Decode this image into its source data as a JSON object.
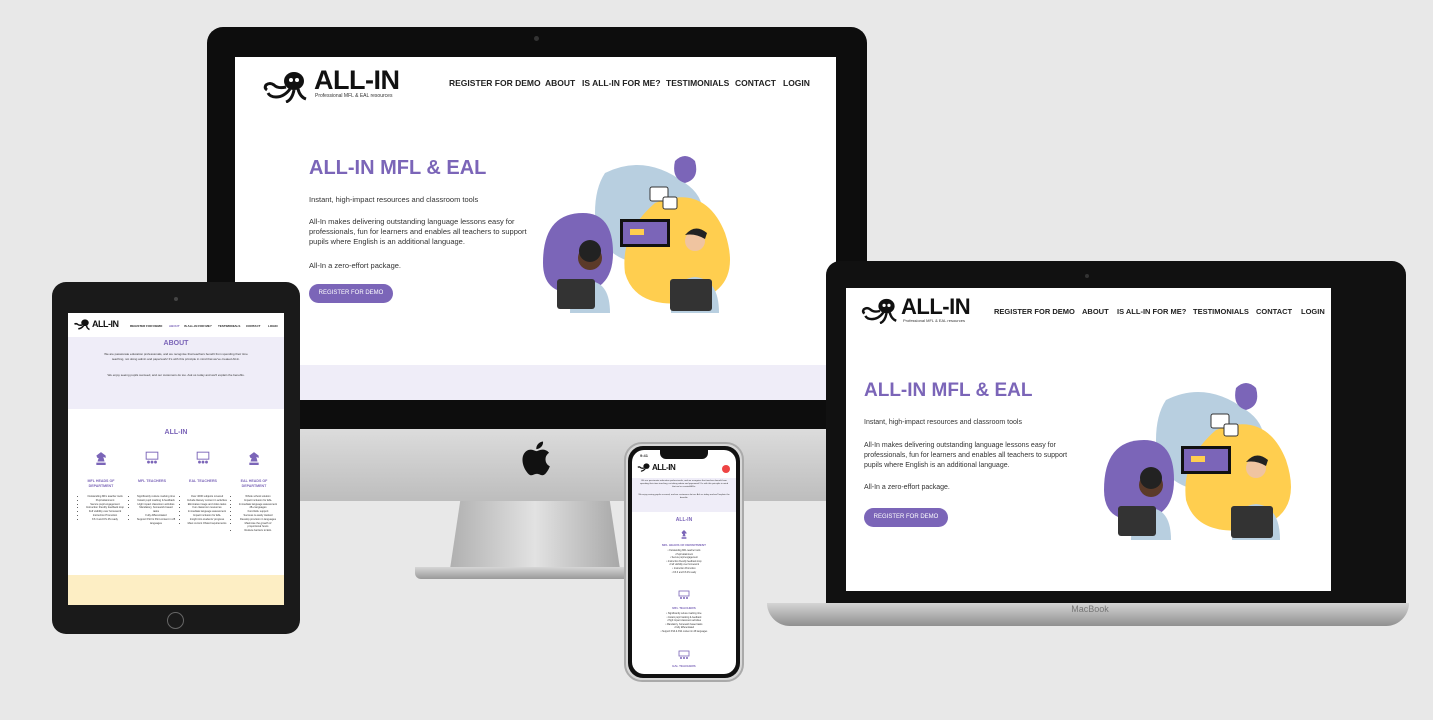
{
  "site": {
    "logo": "ALL-IN",
    "tagline": "Professional MFL & EAL resources",
    "nav": [
      "REGISTER FOR DEMO",
      "ABOUT",
      "IS ALL-IN FOR ME?",
      "TESTIMONIALS",
      "CONTACT",
      "LOGIN"
    ],
    "hero": {
      "title": "ALL-IN MFL & EAL",
      "p1": "Instant, high-impact resources and classroom tools",
      "p2": "All-In makes delivering outstanding language lessons easy for professionals, fun for learners and enables all teachers to support pupils where English is an additional language.",
      "p3": "All-In a zero-effort package.",
      "cta": "REGISTER FOR DEMO"
    }
  },
  "devices": {
    "macbook_label": "MacBook",
    "iphone_time": "9:41"
  },
  "tablet": {
    "about_title": "ABOUT",
    "about_p1": "We are passionate education professionals, and we recognise that teachers benefit from spending their time teaching, not doing admin and paperwork! It's with this principle in mind that we've created All-In.",
    "about_p2": "We enjoy seeing pupils succeed, and our customers do too. Ask us today and we'll explain the benefits.",
    "section_title": "ALL-IN",
    "columns": [
      {
        "title": "MFL HEADS OF DEPARTMENT",
        "items": [
          "Outstanding MFL teacher tools",
          "Pupil attainment",
          "Secure pupil engagement",
          "Instruction friendly feedback loop",
          "Full visibility over homework",
          "Instruction Promotion",
          "KS 3 and KS 4S ready"
        ]
      },
      {
        "title": "MFL TEACHERS",
        "items": [
          "Significantly reduce marking time",
          "Instant pupil marking & feedback",
          "High impact classroom activities",
          "Mandatory, homework based tasks",
          "Fully differentiated",
          "Support KS3 & KS4 content in 28 languages"
        ]
      },
      {
        "title": "EAL TEACHERS",
        "items": [
          "Over 4000 subjects covered",
          "Include literacy content in activities",
          "Eliminates image and video tasks",
          "Fun classroom resources",
          "Immediate language assessment",
          "Impact inclusion for EAL",
          "Insight into students' progress",
          "Meet current Ofsted requirements"
        ]
      },
      {
        "title": "EAL HEADS OF DEPARTMENT",
        "items": [
          "Whole school solution",
          "Impact inclusion for EAL",
          "Immediate language assessment",
          "28+ languages",
          "Fund EAL support",
          "Success is easily tracked",
          "Develop provision in languages",
          "Maximise the growth of proportional hours",
          "Reduce barriers to EAL"
        ]
      }
    ]
  },
  "phone": {
    "logo": "ALL-IN",
    "about_p1": "We are passionate education professionals, and we recognise that teachers benefit from spending their time teaching, not doing admin and paperwork! It's with this principle in mind that we've created All-In.",
    "about_p2": "We enjoy seeing pupils succeed, and our customers do too. Ask us today and we'll explain the benefits.",
    "section_title": "ALL-IN",
    "col1_title": "MFL HEADS OF DEPARTMENT",
    "col1_items": [
      "Outstanding MFL teacher tools",
      "Pupil attainment",
      "Secure pupil engagement",
      "Instruction friendly feedback loop",
      "Full visibility over homework",
      "Instruction Promotion",
      "KS 3 and KS 4S ready"
    ],
    "col2_title": "MFL TEACHERS",
    "col2_items": [
      "Significantly reduce marking time",
      "Instant pupil marking & feedback",
      "High impact classroom activities",
      "Mandatory, homework based tasks",
      "Fully differentiated",
      "Support KS3 & KS4 content in 28 languages"
    ],
    "col3_title": "EAL TEACHERS"
  },
  "colors": {
    "accent": "#7b65b8",
    "blob_blue": "#b8cfe0",
    "blob_yellow": "#ffce4f",
    "blob_purple": "#7b65b8",
    "light_band": "#efedf8",
    "tablet_cream": "#fdeec4"
  }
}
